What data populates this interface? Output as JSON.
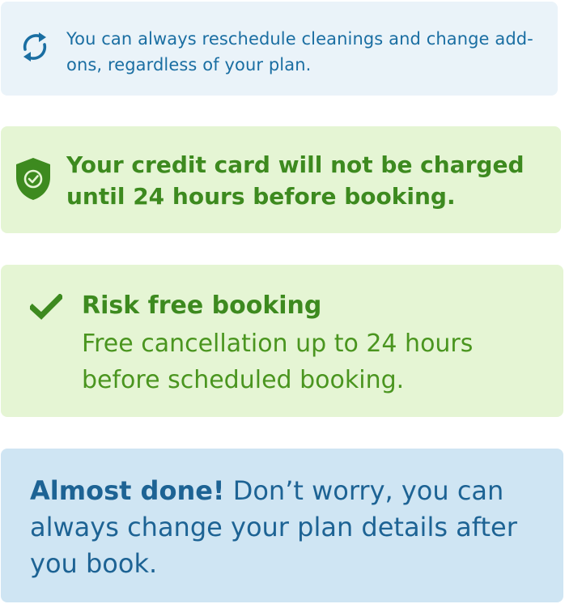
{
  "info_notice": {
    "icon": "sync-icon",
    "text": "You can always reschedule cleanings and change add-ons, regardless of your plan.",
    "color": "#1a6ea2",
    "background": "#eaf3f9"
  },
  "credit_notice": {
    "icon": "shield-check-icon",
    "text": "Your credit card will not be charged until 24 hours before booking.",
    "color": "#3d8a1f",
    "background": "#e5f5d4"
  },
  "risk_notice": {
    "icon": "checkmark-icon",
    "title": "Risk free booking",
    "body": "Free cancellation up to 24 hours before scheduled booking.",
    "color": "#3d8a1f",
    "background": "#e5f5d4"
  },
  "done_notice": {
    "lead": "Almost done!",
    "text": " Don’t worry, you can always change your plan details after you book.",
    "color": "#1d6394",
    "background": "#cfe5f3"
  }
}
